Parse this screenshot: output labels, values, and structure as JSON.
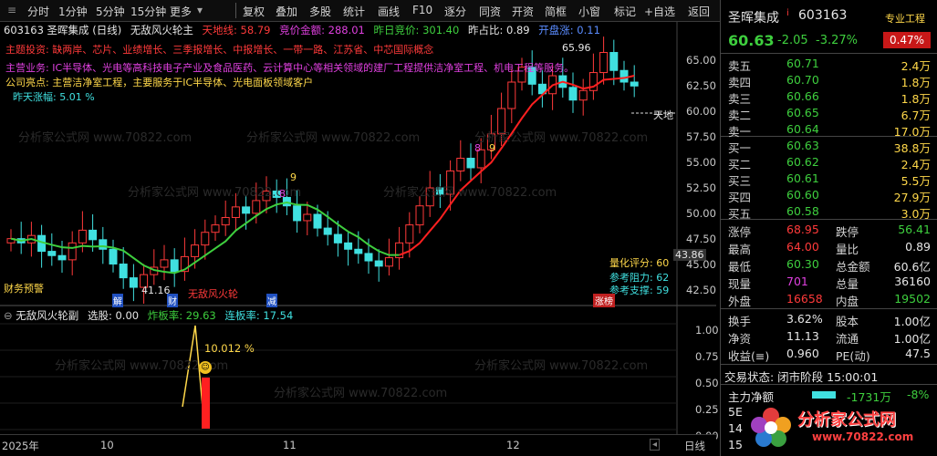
{
  "toolbar": {
    "left_items": [
      "分时",
      "1分钟",
      "5分钟",
      "15分钟",
      "更多"
    ],
    "center_items": [
      "复权",
      "叠加",
      "多股",
      "统计",
      "画线",
      "F10",
      "逐分",
      "同资",
      "开资",
      "简框",
      "小窗",
      "标记",
      "+自选",
      "返回"
    ]
  },
  "main": {
    "title": "603163 圣晖集成 (日线)",
    "indicator_name": "无敌风火轮主",
    "tian_di_xian": "天地线: 58.79",
    "jing_jia_jin_e": "竞价金额: 288.01",
    "zuo_ri_jing_jia": "昨日竞价: 301.40",
    "zuo_zhan_bi": "昨占比: 0.89",
    "kai_pan_jia": "开盘涨: 0.11",
    "line2": "主题投资: 缺两岸、芯片、业绩增长、三季报增长、中报增长、一带一路、江苏省、中芯国际概念",
    "line3": "主营业务: IC半导体、光电等高科技电子产业及食品医药、云计算中心等相关领域的建厂工程提供洁净室工程、机电工程等服务。",
    "line4": "公司亮点: 主营洁净室工程，主要服务于IC半导体、光电面板领域客户",
    "line5": "昨天涨幅: 5.01 %",
    "hi_label": "65.96",
    "lo_label": "41.16",
    "price_label": "43.86",
    "tiandi_tag": "天地",
    "quant_score": "量化评分: 60",
    "ref_resist": "参考阻力: 62",
    "ref_support": "参考支撑: 59",
    "caiwu_tag": "财务预警",
    "jie_tag": "解",
    "cai_tag": "财",
    "jian_tag": "减",
    "zhang_tag": "涨榜",
    "wudi_tag": "无敌风火轮",
    "nine_a": "9",
    "eight_a": "8",
    "eight_b": "8",
    "nine_b": "9",
    "price_axis": [
      "65.00",
      "62.50",
      "60.00",
      "57.50",
      "55.00",
      "52.50",
      "50.00",
      "47.50",
      "45.00",
      "42.50"
    ]
  },
  "sub": {
    "title": "无敌风火轮副",
    "xuan_gu": "选股: 0.00",
    "zha_ban": "炸板率: 29.63",
    "lian_ban": "连板率: 17.54",
    "peak_label": "10.012 %",
    "axis": [
      "1.00",
      "0.75",
      "0.50",
      "0.25",
      "0.00"
    ]
  },
  "bottom_axis": {
    "labels": [
      "2025年",
      "10",
      "11",
      "12"
    ],
    "right_label": "日线"
  },
  "quote": {
    "name": "圣晖集成",
    "code": "603163",
    "tag": "专业工程",
    "price": "60.63",
    "change": "-2.05",
    "change_pct": "-3.27%",
    "turnover_tag": "0.47%",
    "asks": [
      {
        "label": "卖五",
        "price": "60.71",
        "vol": "2.4万"
      },
      {
        "label": "卖四",
        "price": "60.70",
        "vol": "1.8万"
      },
      {
        "label": "卖三",
        "price": "60.66",
        "vol": "1.8万"
      },
      {
        "label": "卖二",
        "price": "60.65",
        "vol": "6.7万"
      },
      {
        "label": "卖一",
        "price": "60.64",
        "vol": "17.0万"
      }
    ],
    "bids": [
      {
        "label": "买一",
        "price": "60.63",
        "vol": "38.8万"
      },
      {
        "label": "买二",
        "price": "60.62",
        "vol": "2.4万"
      },
      {
        "label": "买三",
        "price": "60.61",
        "vol": "5.5万"
      },
      {
        "label": "买四",
        "price": "60.60",
        "vol": "27.9万"
      },
      {
        "label": "买五",
        "price": "60.58",
        "vol": "3.0万"
      }
    ],
    "stats": [
      {
        "k1": "涨停",
        "v1": "68.95",
        "c1": "#ff3a3a",
        "k2": "跌停",
        "v2": "56.41",
        "c2": "#3ecf3e"
      },
      {
        "k1": "最高",
        "v1": "64.00",
        "c1": "#ff3a3a",
        "k2": "量比",
        "v2": "0.89",
        "c2": "#e6e6e6"
      },
      {
        "k1": "最低",
        "v1": "60.30",
        "c1": "#3ecf3e",
        "k2": "总金额",
        "v2": "60.6亿",
        "c2": "#e6e6e6"
      },
      {
        "k1": "现量",
        "v1": "701",
        "c1": "#e040e0",
        "k2": "总量",
        "v2": "36160",
        "c2": "#e6e6e6"
      },
      {
        "k1": "外盘",
        "v1": "16658",
        "c1": "#ff3a3a",
        "k2": "内盘",
        "v2": "19502",
        "c2": "#3ecf3e"
      }
    ],
    "fund": [
      {
        "k1": "换手",
        "v1": "3.62%",
        "k2": "股本",
        "v2": "1.00亿"
      },
      {
        "k1": "净资",
        "v1": "11.13",
        "k2": "流通",
        "v2": "1.00亿"
      },
      {
        "k1": "收益(≡)",
        "v1": "0.960",
        "k2": "PE(动)",
        "v2": "47.5"
      }
    ],
    "trade_state": "交易状态: 闭市阶段 15:00:01",
    "main_flow_label": "主力净额",
    "main_flow_value": "-1731万",
    "main_flow_pct": "-8%",
    "row_5e": "5E",
    "row_14": "14",
    "row_15": "15",
    "logo_text": "分析家公式网",
    "logo_url": "www.70822.com"
  },
  "watermark": "分析家公式网 www.70822.com"
}
